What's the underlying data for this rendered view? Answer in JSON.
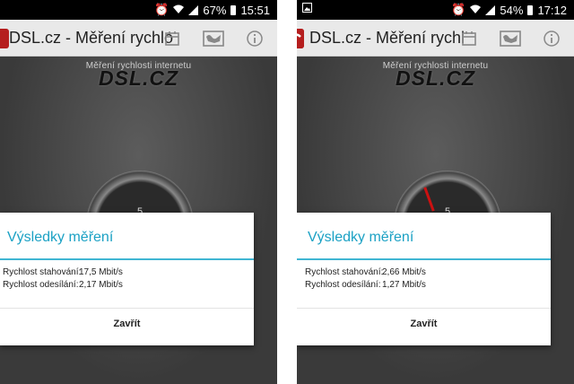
{
  "left": {
    "status": {
      "battery": "67%",
      "time": "15:51"
    },
    "app_title": "DSL.cz - Měření rychlo",
    "brand_subtitle": "Měření rychlosti internetu",
    "brand_logo": "DSL.CZ",
    "gauge_label": "5",
    "dialog": {
      "title": "Výsledky měření",
      "download_label": "Rychlost stahování:",
      "download_value": "17,5 Mbit/s",
      "upload_label": "Rychlost odesílání:",
      "upload_value": "2,17 Mbit/s",
      "close_button": "Zavřít"
    }
  },
  "right": {
    "status": {
      "battery": "54%",
      "time": "17:12"
    },
    "app_title": "DSL.cz - Měření rychl",
    "brand_subtitle": "Měření rychlosti internetu",
    "brand_logo": "DSL.CZ",
    "gauge_label": "5",
    "dialog": {
      "title": "Výsledky měření",
      "download_label": "Rychlost stahování:",
      "download_value": "2,66 Mbit/s",
      "upload_label": "Rychlost odesílání:",
      "upload_value": "1,27 Mbit/s",
      "close_button": "Zavřít"
    }
  },
  "icons": [
    "alarm-icon",
    "wifi-icon",
    "signal-icon",
    "battery-icon",
    "image-icon",
    "app-logo-icon",
    "calendar-icon",
    "map-icon",
    "info-icon"
  ],
  "colors": {
    "accent": "#1ba1c4",
    "statusbar": "#000000",
    "appbar": "#e9e9e9",
    "background": "#3c3c3c"
  }
}
